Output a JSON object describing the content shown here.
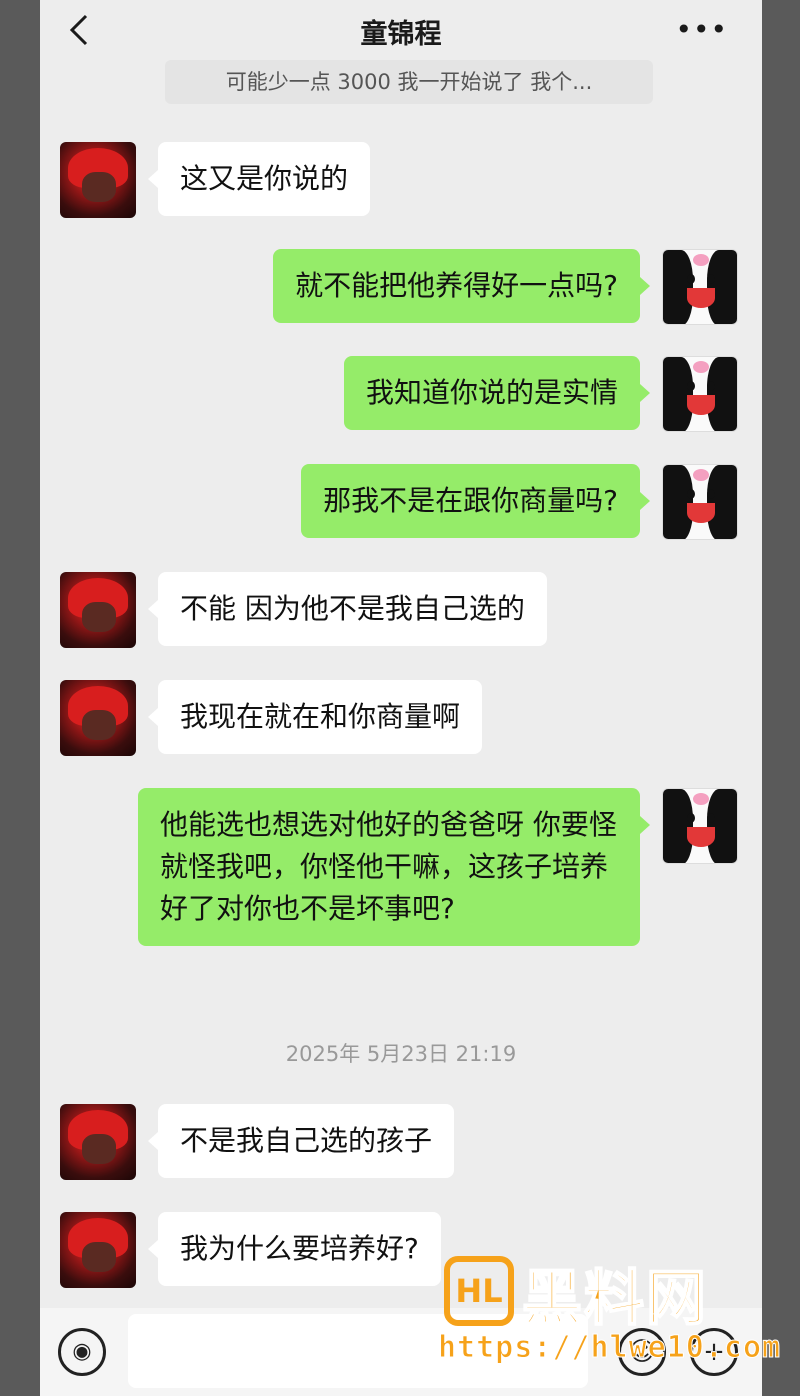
{
  "header": {
    "title": "童锦程",
    "back_icon": "chevron-left-icon",
    "more_label": "•••",
    "pinned_preview": "可能少一点 3000 我一开始说了 我个..."
  },
  "messages": [
    {
      "side": "left",
      "text": "这又是你说的"
    },
    {
      "side": "right",
      "text": "就不能把他养得好一点吗?"
    },
    {
      "side": "right",
      "text": "我知道你说的是实情"
    },
    {
      "side": "right",
      "text": "那我不是在跟你商量吗?"
    },
    {
      "side": "left",
      "text": "不能 因为他不是我自己选的"
    },
    {
      "side": "left",
      "text": "我现在就在和你商量啊"
    },
    {
      "side": "right",
      "text": "他能选也想选对他好的爸爸呀 你要怪就怪我吧，你怪他干嘛，这孩子培养好了对你也不是坏事吧?"
    },
    {
      "side": "left",
      "text": "不是我自己选的孩子"
    },
    {
      "side": "left",
      "text": "我为什么要培养好?"
    }
  ],
  "timestamp": "2025年 5月23日 21:19",
  "bottombar": {
    "voice_icon": "voice-icon",
    "emoji_icon": "emoji-icon",
    "plus_icon": "plus-icon"
  },
  "watermark": {
    "logo": "HL",
    "brand": "黑料网",
    "url": "https://hlwe10.com"
  },
  "colors": {
    "outgoing_bubble": "#95ec69",
    "incoming_bubble": "#ffffff",
    "background": "#ededed",
    "watermark": "#f6a21a"
  }
}
